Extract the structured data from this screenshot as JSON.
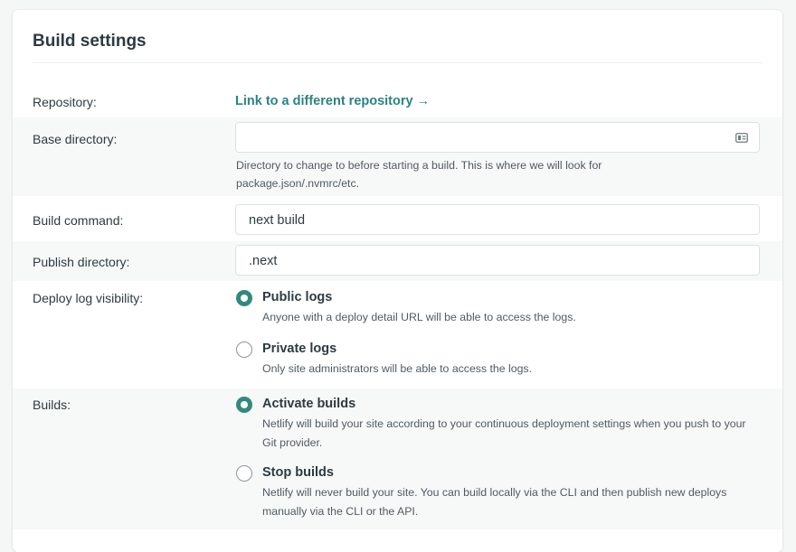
{
  "section": {
    "title": "Build settings"
  },
  "repository": {
    "label": "Repository:",
    "link_text": "Link to a different repository →"
  },
  "base_directory": {
    "label": "Base directory:",
    "value": "",
    "icon": "text-field-icon",
    "help": "Directory to change to before starting a build. This is where we will look for package.json/.nvmrc/etc."
  },
  "build_command": {
    "label": "Build command:",
    "value": "next build"
  },
  "publish_directory": {
    "label": "Publish directory:",
    "value": ".next"
  },
  "deploy_log_visibility": {
    "label": "Deploy log visibility:",
    "options": [
      {
        "title": "Public logs",
        "description": "Anyone with a deploy detail URL will be able to access the logs.",
        "selected": true
      },
      {
        "title": "Private logs",
        "description": "Only site administrators will be able to access the logs.",
        "selected": false
      }
    ]
  },
  "builds": {
    "label": "Builds:",
    "options": [
      {
        "title": "Activate builds",
        "description": "Netlify will build your site according to your continuous deployment settings when you push to your Git provider.",
        "selected": true
      },
      {
        "title": "Stop builds",
        "description": "Netlify will never build your site. You can build locally via the CLI and then publish new deploys manually via the CLI or the API.",
        "selected": false
      }
    ]
  },
  "colors": {
    "accent": "#318a7d",
    "link": "#2b8383"
  }
}
